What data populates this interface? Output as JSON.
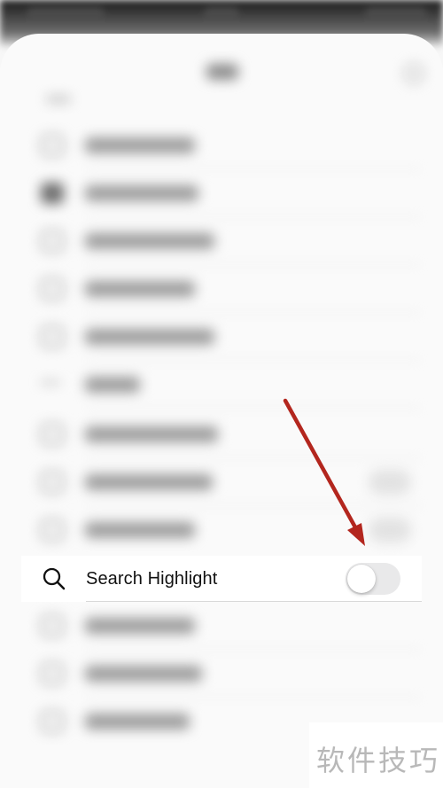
{
  "settings_row": {
    "icon": "search-icon",
    "label": "Search Highlight",
    "toggle_on": false
  },
  "annotation": {
    "arrow_color": "#b3261e"
  },
  "watermark": {
    "text": "软件技巧"
  },
  "colors": {
    "toggle_off_track": "#e9e9ea",
    "background": "#f7f7f7"
  }
}
